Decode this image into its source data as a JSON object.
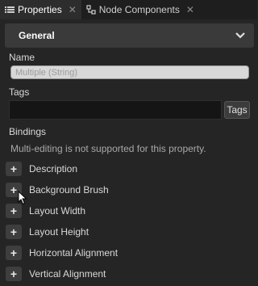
{
  "tabs": [
    {
      "label": "Properties",
      "icon": "list-icon",
      "active": true
    },
    {
      "label": "Node Components",
      "icon": "components-icon",
      "active": false
    }
  ],
  "section": {
    "title": "General"
  },
  "name": {
    "label": "Name",
    "value": "Multiple (String)"
  },
  "tags": {
    "label": "Tags",
    "button_label": "Tags"
  },
  "bindings": {
    "label": "Bindings",
    "note": "Multi-editing is not supported for this property.",
    "items": [
      {
        "label": "Description"
      },
      {
        "label": "Background Brush"
      },
      {
        "label": "Layout Width"
      },
      {
        "label": "Layout Height"
      },
      {
        "label": "Horizontal Alignment"
      },
      {
        "label": "Vertical Alignment"
      }
    ]
  },
  "colors": {
    "background": "#252525",
    "header": "#3a3a3a",
    "field_dark": "#151515"
  }
}
